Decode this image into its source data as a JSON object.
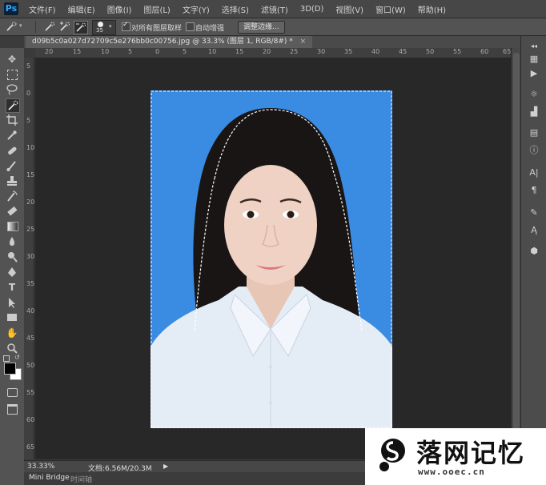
{
  "app": {
    "logo": "Ps"
  },
  "menu": [
    "文件(F)",
    "编辑(E)",
    "图像(I)",
    "图层(L)",
    "文字(Y)",
    "选择(S)",
    "滤镜(T)",
    "3D(D)",
    "视图(V)",
    "窗口(W)",
    "帮助(H)"
  ],
  "options": {
    "brush_size": "35",
    "sample_all_layers_label": "对所有图层取样",
    "sample_all_layers_checked": true,
    "auto_enhance_label": "自动增强",
    "auto_enhance_checked": false,
    "refine_edge_button": "调整边缘..."
  },
  "document": {
    "tab_title": "d09b5c0a027d72709c5e276bb0c00756.jpg @ 33.3% (图层 1, RGB/8#) *"
  },
  "rulers": {
    "top": [
      "20",
      "15",
      "10",
      "5",
      "0",
      "5",
      "10",
      "15",
      "20",
      "25",
      "30",
      "35",
      "40",
      "45",
      "50",
      "55",
      "60",
      "65"
    ],
    "left": [
      "5",
      "0",
      "5",
      "10",
      "15",
      "20",
      "25",
      "30",
      "35",
      "40",
      "45",
      "50",
      "55",
      "60",
      "65"
    ]
  },
  "status": {
    "zoom": "33.33%",
    "doc_info": "文档:6.56M/20.3M"
  },
  "bottom_tabs": [
    "Mini Bridge",
    "时间轴"
  ],
  "watermark": {
    "text": "落网记忆",
    "url": "www.ooec.cn"
  },
  "colors": {
    "photo_background": "#3a8be2",
    "foreground": "#000000",
    "background": "#ffffff"
  }
}
